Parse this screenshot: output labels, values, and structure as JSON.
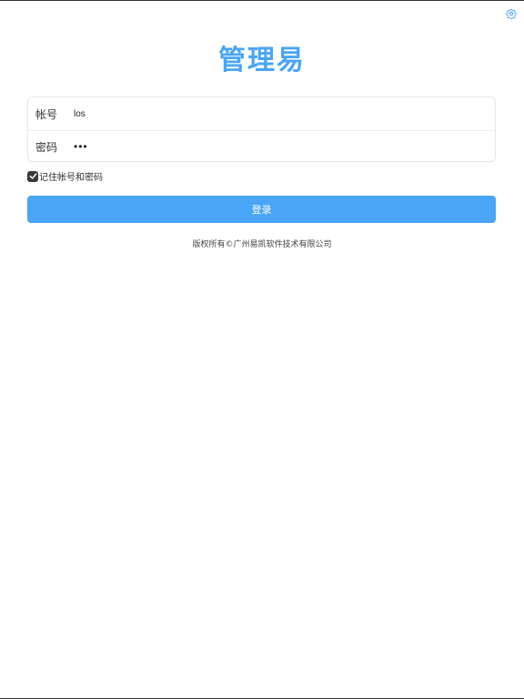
{
  "app": {
    "title": "管理易",
    "accent_color": "#49a5f6"
  },
  "header": {
    "settings_icon": "gear-icon"
  },
  "form": {
    "account": {
      "label": "帐号",
      "value": "los"
    },
    "password": {
      "label": "密码",
      "value": "•••"
    },
    "remember": {
      "label": "记住帐号和密码",
      "checked": true
    },
    "login_label": "登录"
  },
  "footer": {
    "copyright": "版权所有©广州易凯软件技术有限公司"
  }
}
